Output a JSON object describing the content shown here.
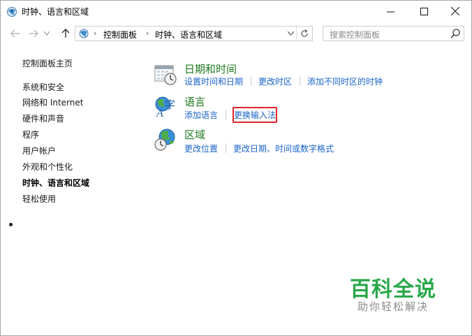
{
  "window": {
    "title": "时钟、语言和区域"
  },
  "address_bar": {
    "crumbs": [
      "控制面板",
      "时钟、语言和区域"
    ],
    "search_placeholder": "搜索控制面板"
  },
  "sidebar": {
    "items": [
      {
        "label": "控制面板主页"
      },
      {
        "label": "系统和安全"
      },
      {
        "label": "网络和 Internet"
      },
      {
        "label": "硬件和声音"
      },
      {
        "label": "程序"
      },
      {
        "label": "用户帐户"
      },
      {
        "label": "外观和个性化"
      },
      {
        "label": "时钟、语言和区域"
      },
      {
        "label": "轻松使用"
      }
    ],
    "current_index": 7
  },
  "categories": [
    {
      "title": "日期和时间",
      "icon": "calendar-clock-icon",
      "links": [
        "设置时间和日期",
        "更改时区",
        "添加不同时区的时钟"
      ]
    },
    {
      "title": "语言",
      "icon": "language-globe-icon",
      "links": [
        "添加语言",
        "更换输入法"
      ]
    },
    {
      "title": "区域",
      "icon": "region-globe-clock-icon",
      "links": [
        "更改位置",
        "更改日期、时间或数字格式"
      ]
    }
  ],
  "annotation": {
    "highlighted_link": "更换输入法",
    "color": "#e0242c"
  },
  "watermark": {
    "title": "百科全说",
    "subtitle": "助你轻松解决"
  },
  "colors": {
    "category_title": "#1f7a1f",
    "link": "#1a64c8",
    "watermark_green": "#2aa84a"
  }
}
